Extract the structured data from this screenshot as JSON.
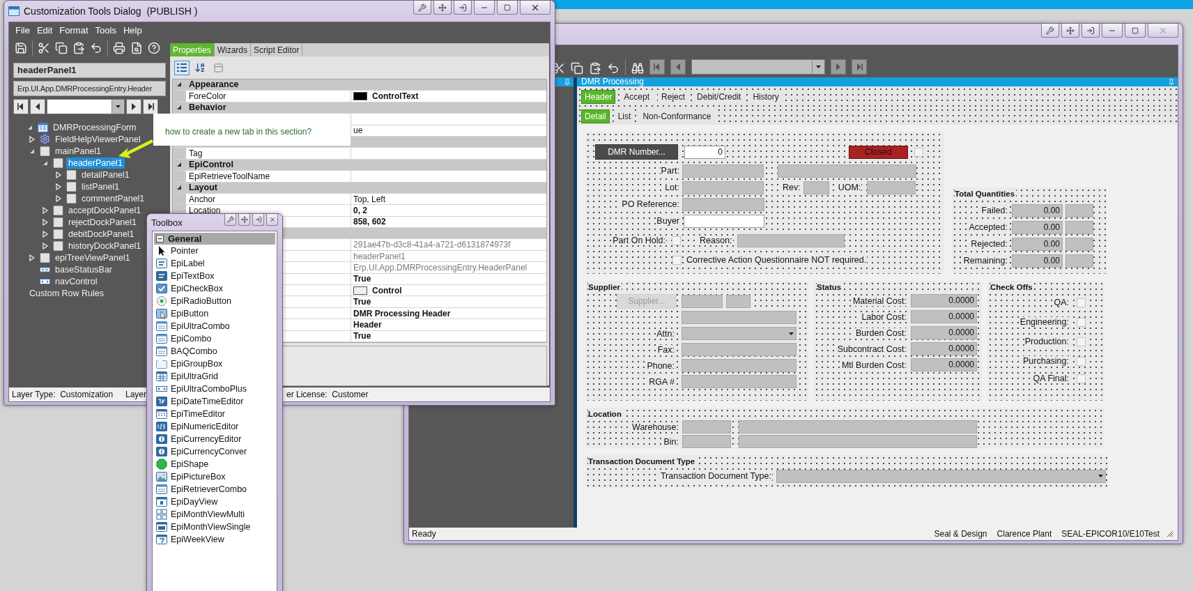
{
  "customization_dialog": {
    "title": "Customization Tools Dialog  (PUBLISH )",
    "menu": [
      "File",
      "Edit",
      "Format",
      "Tools",
      "Help"
    ],
    "selected_control": "headerPanel1",
    "control_type": "Erp.UI.App.DMRProcessingEntry.Header",
    "tree": [
      {
        "label": "DMRProcessingForm",
        "kind": "form",
        "expanded": true,
        "selected": false,
        "children": [
          {
            "label": "FieldHelpViewerPanel",
            "kind": "gear",
            "expanded": false,
            "selected": false
          },
          {
            "label": "mainPanel1",
            "kind": "panel",
            "expanded": true,
            "selected": false,
            "children": [
              {
                "label": "headerPanel1",
                "kind": "panel",
                "expanded": true,
                "selected": true,
                "children": [
                  {
                    "label": "detailPanel1",
                    "kind": "panel",
                    "expanded": false,
                    "selected": false
                  },
                  {
                    "label": "listPanel1",
                    "kind": "panel",
                    "expanded": false,
                    "selected": false
                  },
                  {
                    "label": "commentPanel1",
                    "kind": "panel",
                    "expanded": false,
                    "selected": false
                  }
                ]
              },
              {
                "label": "acceptDockPanel1",
                "kind": "panel",
                "expanded": false,
                "selected": false
              },
              {
                "label": "rejectDockPanel1",
                "kind": "panel",
                "expanded": false,
                "selected": false
              },
              {
                "label": "debitDockPanel1",
                "kind": "panel",
                "expanded": false,
                "selected": false
              },
              {
                "label": "historyDockPanel1",
                "kind": "panel",
                "expanded": false,
                "selected": false
              }
            ]
          },
          {
            "label": "epiTreeViewPanel1",
            "kind": "panel",
            "expanded": false,
            "selected": false
          },
          {
            "label": "baseStatusBar",
            "kind": "statusbar",
            "selected": false
          },
          {
            "label": "navControl",
            "kind": "nav",
            "selected": false
          }
        ]
      },
      {
        "label": "Custom Row Rules",
        "selected": false
      }
    ],
    "tabs": [
      {
        "label": "Properties",
        "selected": true
      },
      {
        "label": "Wizards",
        "selected": false
      },
      {
        "label": "Script Editor",
        "selected": false
      }
    ],
    "properties": [
      {
        "kind": "category",
        "name": "Appearance"
      },
      {
        "kind": "property",
        "name": "ForeColor",
        "value": "ControlText",
        "color": "#000000",
        "modified": true,
        "read_only": false
      },
      {
        "kind": "category",
        "name": "Behavior"
      },
      {
        "kind": "property"
      },
      {
        "kind": "property",
        "value": "ue",
        "modified": false,
        "read_only": false
      },
      {
        "kind": "category"
      },
      {
        "kind": "property",
        "name": "Tag"
      },
      {
        "kind": "category",
        "name": "EpiControl"
      },
      {
        "kind": "property",
        "name": "EpiRetrieveToolName"
      },
      {
        "kind": "category",
        "name": "Layout"
      },
      {
        "kind": "property",
        "name": "Anchor",
        "value": "Top, Left",
        "modified": false,
        "read_only": false
      },
      {
        "kind": "property",
        "name": "Location",
        "value": "0, 2",
        "modified": true,
        "read_only": false
      },
      {
        "kind": "property",
        "value": "858, 602",
        "modified": true,
        "read_only": false
      },
      {
        "kind": "category"
      },
      {
        "kind": "property",
        "value": "291ae47b-d3c8-41a4-a721-d6131874973f",
        "modified": false,
        "read_only": true
      },
      {
        "kind": "property",
        "value": "headerPanel1",
        "modified": false,
        "read_only": true
      },
      {
        "kind": "property",
        "value": "Erp.UI.App.DMRProcessingEntry.HeaderPanel",
        "modified": false,
        "read_only": true
      },
      {
        "kind": "property",
        "value": "True",
        "modified": true,
        "read_only": false
      },
      {
        "kind": "property",
        "value": "Control",
        "color": "#f0f0f0",
        "modified": true,
        "read_only": false
      },
      {
        "kind": "property",
        "value": "True",
        "modified": true,
        "read_only": false
      },
      {
        "kind": "property",
        "value": "DMR Processing Header",
        "modified": true,
        "read_only": false
      },
      {
        "kind": "property",
        "value": "Header",
        "modified": true,
        "read_only": false
      },
      {
        "kind": "property",
        "value": "True",
        "modified": true,
        "read_only": false
      }
    ],
    "status_bar": [
      "Layer Type:  Customization",
      "Layer",
      "er License:  Customer"
    ]
  },
  "callout": {
    "text": "how to create a new tab in this section?"
  },
  "toolbox": {
    "title": "Toolbox",
    "section": "General",
    "items": [
      {
        "label": "Pointer",
        "kind": "pointer"
      },
      {
        "label": "EpiLabel",
        "kind": "label"
      },
      {
        "label": "EpiTextBox",
        "kind": "textbox"
      },
      {
        "label": "EpiCheckBox",
        "kind": "checkbox"
      },
      {
        "label": "EpiRadioButton",
        "kind": "radio"
      },
      {
        "label": "EpiButton",
        "kind": "button"
      },
      {
        "label": "EpiUltraCombo",
        "kind": "combo"
      },
      {
        "label": "EpiCombo",
        "kind": "combo"
      },
      {
        "label": "BAQCombo",
        "kind": "combo"
      },
      {
        "label": "EpiGroupBox",
        "kind": "groupbox"
      },
      {
        "label": "EpiUltraGrid",
        "kind": "grid"
      },
      {
        "label": "EpiUltraComboPlus",
        "kind": "comboplus"
      },
      {
        "label": "EpiDateTimeEditor",
        "kind": "datetime"
      },
      {
        "label": "EpiTimeEditor",
        "kind": "time"
      },
      {
        "label": "EpiNumericEditor",
        "kind": "numeric"
      },
      {
        "label": "EpiCurrencyEditor",
        "kind": "currency"
      },
      {
        "label": "EpiCurrencyConver",
        "kind": "currency"
      },
      {
        "label": "EpiShape",
        "kind": "shape"
      },
      {
        "label": "EpiPictureBox",
        "kind": "picture"
      },
      {
        "label": "EpiRetrieverCombo",
        "kind": "combo"
      },
      {
        "label": "EpiDayView",
        "kind": "day"
      },
      {
        "label": "EpiMonthViewMulti",
        "kind": "monthmulti"
      },
      {
        "label": "EpiMonthViewSingle",
        "kind": "monthsingle"
      },
      {
        "label": "EpiWeekView",
        "kind": "week"
      }
    ]
  },
  "dmr_window": {
    "title": "DMR Processing",
    "tabs": [
      {
        "label": "Header",
        "selected": true
      },
      {
        "label": "Accept",
        "selected": false
      },
      {
        "label": "Reject",
        "selected": false
      },
      {
        "label": "Debit/Credit",
        "selected": false
      },
      {
        "label": "History",
        "selected": false
      }
    ],
    "subtabs": [
      {
        "label": "Detail",
        "selected": true
      },
      {
        "label": "List",
        "selected": false
      },
      {
        "label": "Non-Conformance",
        "selected": false
      }
    ],
    "header_group": {
      "dmr_button": "DMR Number...",
      "dmr_number": "0",
      "status_button": "Closed",
      "status_checked": false,
      "part_label": "Part:",
      "lot_label": "Lot:",
      "rev_label": "Rev:",
      "uom_label": "UOM:",
      "po_label": "PO Reference:",
      "buyer_label": "Buyer",
      "on_hold_label": "Part On Hold:",
      "on_hold_checked": false,
      "reason_label": "Reason:",
      "corrective_label": "Corrective Action Questionnaire NOT required.",
      "corrective_checked": false
    },
    "total_quantities": {
      "title": "Total Quantities",
      "rows": [
        {
          "label": "Failed:",
          "value": "0.00"
        },
        {
          "label": "Accepted:",
          "value": "0.00"
        },
        {
          "label": "Rejected:",
          "value": "0.00"
        },
        {
          "label": "Remaining:",
          "value": "0.00"
        }
      ]
    },
    "supplier": {
      "title": "Supplier",
      "button": "Supplier...",
      "button_disabled": true,
      "rows": [
        {
          "kind": "field"
        },
        {
          "kind": "combo",
          "label": "Attn:"
        },
        {
          "kind": "field",
          "label": "Fax:"
        },
        {
          "kind": "field",
          "label": "Phone:"
        },
        {
          "kind": "field",
          "label": "RGA #"
        }
      ]
    },
    "status": {
      "title": "Status",
      "rows": [
        {
          "label": "Material Cost:",
          "value": "0.0000"
        },
        {
          "label": "Labor Cost:",
          "value": "0.0000"
        },
        {
          "label": "Burden Cost:",
          "value": "0.0000"
        },
        {
          "label": "Subcontract Cost:",
          "value": "0.0000"
        },
        {
          "label": "Mtl Burden Cost:",
          "value": "0.0000"
        }
      ]
    },
    "check_offs": {
      "title": "Check Offs",
      "rows": [
        {
          "label": "QA:",
          "checked": false
        },
        {
          "label": "Engineering:",
          "checked": false
        },
        {
          "label": "Production:",
          "checked": false
        },
        {
          "label": "Purchasing:",
          "checked": false
        },
        {
          "label": "QA Final:",
          "checked": false
        }
      ]
    },
    "location": {
      "title": "Location",
      "rows": [
        {
          "label": "Warehouse:"
        },
        {
          "label": "Bin:"
        }
      ]
    },
    "transaction_document_type": {
      "title": "Transaction Document Type",
      "label": "Transaction Document Type:"
    },
    "status_bar": {
      "left": "Ready",
      "right": [
        "Seal & Design",
        "Clarence Plant",
        "SEAL-EPICOR10/E10Test"
      ]
    }
  }
}
